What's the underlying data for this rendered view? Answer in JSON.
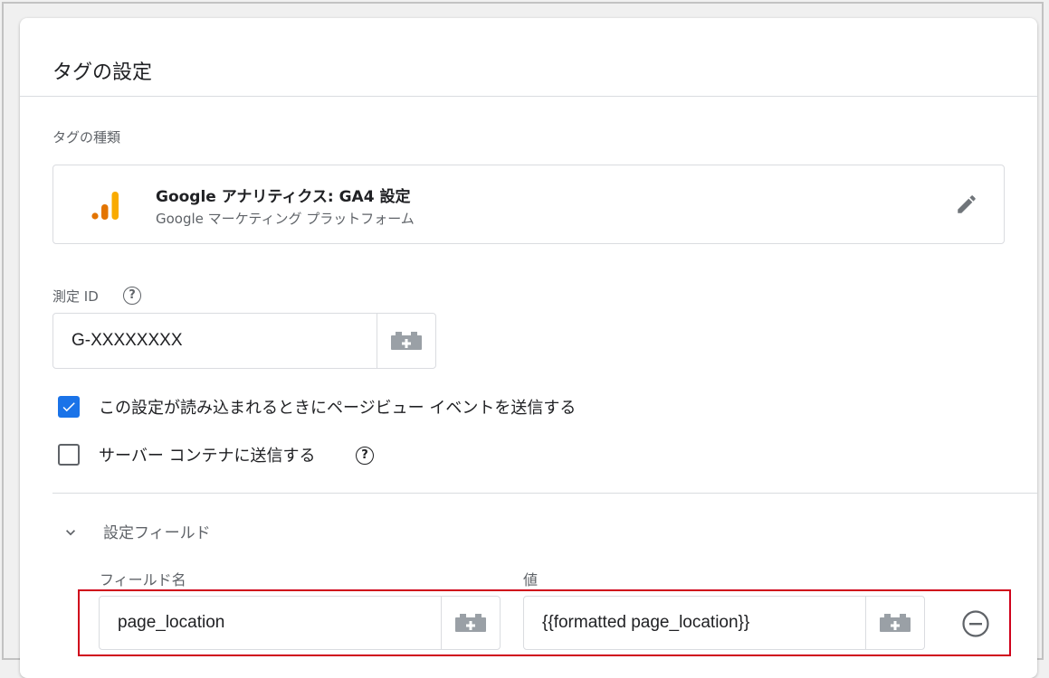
{
  "panel": {
    "title": "タグの設定"
  },
  "tag_type": {
    "section_label": "タグの種類",
    "name": "Google アナリティクス: GA4 設定",
    "vendor": "Google マーケティング プラットフォーム",
    "icon": "google-analytics-icon",
    "edit_icon": "pencil-icon"
  },
  "measurement_id": {
    "label": "測定 ID",
    "help_icon": "?",
    "value": "G-XXXXXXXX",
    "variable_button_icon": "variable-brick-icon"
  },
  "checkboxes": [
    {
      "label": "この設定が読み込まれるときにページビュー イベントを送信する",
      "checked": true
    },
    {
      "label": "サーバー コンテナに送信する",
      "checked": false,
      "help_icon": "?"
    }
  ],
  "fields_to_set": {
    "section_label": "設定フィールド",
    "expanded": true,
    "column_headers": {
      "name": "フィールド名",
      "value": "値"
    },
    "rows": [
      {
        "field_name": "page_location",
        "value": "{{formatted page_location}}"
      }
    ]
  },
  "colors": {
    "accent": "#1a73e8",
    "ga_orange_dark": "#e37400",
    "ga_orange_light": "#f9ab00",
    "highlight": "#d0021b"
  }
}
